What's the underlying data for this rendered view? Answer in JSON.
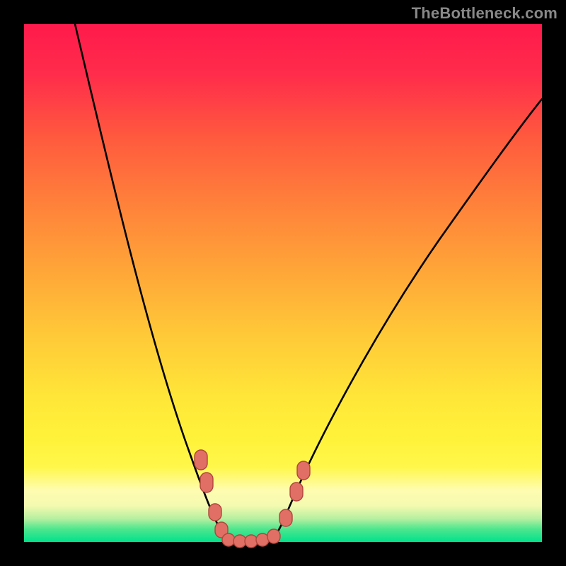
{
  "watermark": "TheBottleneck.com",
  "colors": {
    "frame": "#000000",
    "curve": "#000000",
    "marker_fill": "#e16f65",
    "marker_stroke": "#b0463c",
    "gradient_stops": [
      {
        "offset": 0.0,
        "hex": "#ff1a4b"
      },
      {
        "offset": 0.1,
        "hex": "#ff2d4b"
      },
      {
        "offset": 0.22,
        "hex": "#ff5a3e"
      },
      {
        "offset": 0.35,
        "hex": "#ff823a"
      },
      {
        "offset": 0.48,
        "hex": "#ffa738"
      },
      {
        "offset": 0.6,
        "hex": "#ffc938"
      },
      {
        "offset": 0.72,
        "hex": "#ffe638"
      },
      {
        "offset": 0.8,
        "hex": "#fff23a"
      },
      {
        "offset": 0.855,
        "hex": "#fff74a"
      },
      {
        "offset": 0.9,
        "hex": "#fffcb0"
      },
      {
        "offset": 0.93,
        "hex": "#f4fab0"
      },
      {
        "offset": 0.955,
        "hex": "#b6f0a0"
      },
      {
        "offset": 0.975,
        "hex": "#4ee68e"
      },
      {
        "offset": 1.0,
        "hex": "#00e28a"
      }
    ]
  },
  "chart_data": {
    "type": "line",
    "title": "",
    "xlabel": "",
    "ylabel": "",
    "xlim": [
      0,
      100
    ],
    "ylim": [
      0,
      100
    ],
    "grid": false,
    "legend": false,
    "note": "No axes or tick labels are rendered; x and y are normalized 0–100 to the visible gradient panel (x left→right, y bottom→top). Curve values are read off the pixel positions.",
    "series": [
      {
        "name": "bottleneck-curve",
        "x": [
          10,
          15,
          20,
          25,
          30,
          33,
          35,
          38,
          40,
          42,
          44,
          46,
          48,
          50,
          55,
          60,
          65,
          70,
          80,
          90,
          100
        ],
        "y": [
          100,
          82,
          64,
          48,
          32,
          22,
          14,
          6,
          1,
          0,
          0,
          0,
          1,
          4,
          14,
          27,
          40,
          52,
          70,
          84,
          95
        ]
      }
    ],
    "markers": {
      "description": "Highlighted sample points clustered near the curve minimum.",
      "x": [
        33.0,
        34.2,
        35.8,
        37.0,
        38.4,
        40.5,
        42.7,
        44.9,
        47.0,
        49.4,
        51.4,
        52.8
      ],
      "y": [
        15.3,
        11.2,
        5.7,
        2.5,
        0.8,
        0.5,
        0.5,
        0.8,
        1.5,
        4.6,
        9.3,
        13.0
      ]
    }
  }
}
